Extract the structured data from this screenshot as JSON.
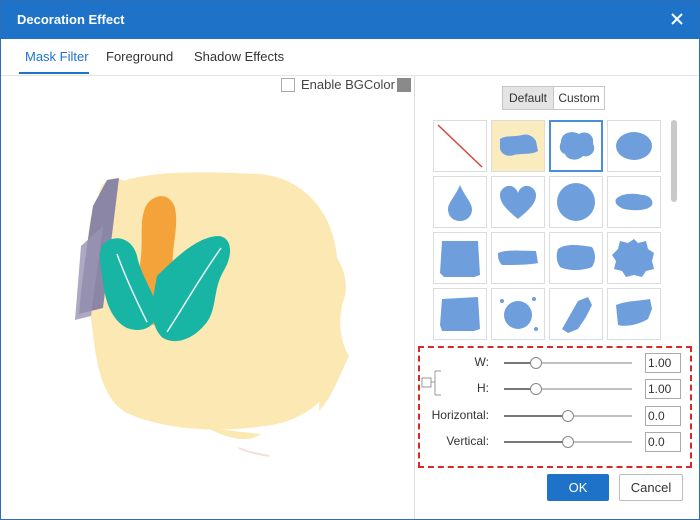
{
  "window": {
    "title": "Decoration Effect",
    "close_icon": "close-icon"
  },
  "tabs": [
    {
      "label": "Mask Filter",
      "active": true
    },
    {
      "label": "Foreground",
      "active": false
    },
    {
      "label": "Shadow Effects",
      "active": false
    }
  ],
  "preview": {
    "enable_bgcolor_label": "Enable BGColor",
    "enable_bgcolor_checked": false,
    "bgcolor": "#8a8a8a"
  },
  "mask_panel": {
    "segments": [
      {
        "label": "Default",
        "selected": true
      },
      {
        "label": "Custom",
        "selected": false
      }
    ],
    "masks": [
      "none",
      "brush-stroke",
      "cloud-blob",
      "soft-ellipse",
      "drop",
      "heart",
      "circle",
      "flat-blob",
      "square-brush",
      "brush-stroke-wide",
      "rough-blob",
      "round-splat",
      "rough-rect",
      "ink-splat",
      "diagonal-splat",
      "brush-wave"
    ],
    "selected_index": 2,
    "highlighted_index": 1,
    "mask_color": "#6e9fdc"
  },
  "sliders": [
    {
      "label": "W:",
      "value": "1.00",
      "position": 0.25
    },
    {
      "label": "H:",
      "value": "1.00",
      "position": 0.25
    },
    {
      "label": "Horizontal:",
      "value": "0.0",
      "position": 0.5
    },
    {
      "label": "Vertical:",
      "value": "0.0",
      "position": 0.5
    }
  ],
  "buttons": {
    "ok": "OK",
    "cancel": "Cancel"
  },
  "colors": {
    "accent": "#1e73c8",
    "highlight_border": "#d42a2a",
    "selected_cell_bg": "#fbecc0"
  }
}
